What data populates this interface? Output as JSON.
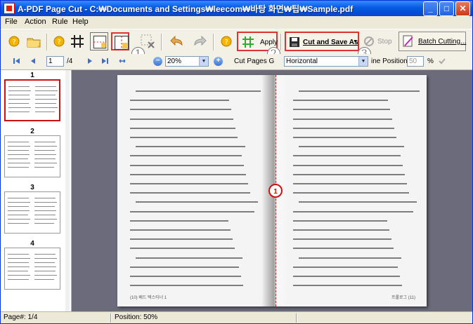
{
  "window": {
    "title": "A-PDF Page Cut - C:₩Documents and Settings₩leecom₩바탕 화면₩팁₩Sample.pdf"
  },
  "menu": [
    "File",
    "Action",
    "Rule",
    "Help"
  ],
  "toolbar": {
    "apply_label": "Apply",
    "cut_save_label": "Cut and Save As",
    "stop_label": "Stop",
    "batch_label": "Batch Cutting...",
    "callouts": [
      "1",
      "2",
      "3"
    ]
  },
  "nav": {
    "page_value": "1",
    "page_total": "/4",
    "zoom_value": "20%",
    "cut_pages_label": "Cut Pages G",
    "cut_mode_value": "Horizontal",
    "line_position_label": "ine Position:",
    "line_position_value": "50",
    "percent_label": "%"
  },
  "thumbnails": [
    {
      "number": "1",
      "selected": true
    },
    {
      "number": "2",
      "selected": false
    },
    {
      "number": "3",
      "selected": false
    },
    {
      "number": "4",
      "selected": false
    }
  ],
  "page": {
    "cut_marker": "1",
    "left_footer": "(10) 배드 텍스티너 1",
    "right_footer": "프롤로그 (11)"
  },
  "status": {
    "page": "Page#: 1/4",
    "position": "Position: 50%"
  },
  "colors": {
    "title_bar": "#0a5fe6",
    "viewer_bg": "#6b6b7b",
    "cut_marker": "#cc1111"
  }
}
